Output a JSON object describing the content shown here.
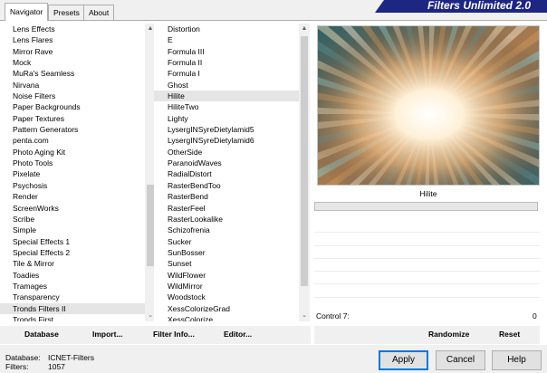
{
  "tabs": [
    {
      "label": "Navigator",
      "active": true
    },
    {
      "label": "Presets",
      "active": false
    },
    {
      "label": "About",
      "active": false
    }
  ],
  "banner_title": "Filters Unlimited 2.0",
  "categories": [
    {
      "label": "Lens Effects"
    },
    {
      "label": "Lens Flares"
    },
    {
      "label": "Mirror Rave"
    },
    {
      "label": "Mock"
    },
    {
      "label": "MuRa's Seamless"
    },
    {
      "label": "Nirvana"
    },
    {
      "label": "Noise Filters"
    },
    {
      "label": "Paper Backgrounds"
    },
    {
      "label": "Paper Textures"
    },
    {
      "label": "Pattern Generators"
    },
    {
      "label": "penta.com"
    },
    {
      "label": "Photo Aging Kit"
    },
    {
      "label": "Photo Tools"
    },
    {
      "label": "Pixelate"
    },
    {
      "label": "Psychosis"
    },
    {
      "label": "Render"
    },
    {
      "label": "ScreenWorks"
    },
    {
      "label": "Scribe"
    },
    {
      "label": "Simple"
    },
    {
      "label": "Special Effects 1"
    },
    {
      "label": "Special Effects 2"
    },
    {
      "label": "Tile & Mirror"
    },
    {
      "label": "Toadies"
    },
    {
      "label": "Tramages"
    },
    {
      "label": "Transparency"
    },
    {
      "label": "Tronds Filters II",
      "selected": true
    },
    {
      "label": "Tronds First"
    }
  ],
  "filters": [
    {
      "label": "Distortion"
    },
    {
      "label": "E"
    },
    {
      "label": "Formula III"
    },
    {
      "label": "Formula II"
    },
    {
      "label": "Formula I"
    },
    {
      "label": "Ghost"
    },
    {
      "label": "Hilite",
      "selected": true
    },
    {
      "label": "HiliteTwo"
    },
    {
      "label": "Lighty"
    },
    {
      "label": "LysergINSyreDietylamid5"
    },
    {
      "label": "LysergINSyreDietylamid6"
    },
    {
      "label": "OtherSide"
    },
    {
      "label": "ParanoidWaves"
    },
    {
      "label": "RadialDistort"
    },
    {
      "label": "RasterBendToo"
    },
    {
      "label": "RasterBend"
    },
    {
      "label": "RasterFeel"
    },
    {
      "label": "RasterLookalike"
    },
    {
      "label": "Schizofrenia"
    },
    {
      "label": "Sucker"
    },
    {
      "label": "SunBosser"
    },
    {
      "label": "Sunset"
    },
    {
      "label": "WildFlower"
    },
    {
      "label": "WildMirror"
    },
    {
      "label": "Woodstock"
    },
    {
      "label": "XessColorizeGrad"
    },
    {
      "label": "XessColorize"
    }
  ],
  "scroll_up_glyph": "▲",
  "scroll_down_glyph": "⌄",
  "preview_name": "Hilite",
  "control": {
    "label": "Control 7:",
    "value": "0"
  },
  "left_buttons": {
    "database": "Database",
    "import": "Import...",
    "filter_info": "Filter Info...",
    "editor": "Editor..."
  },
  "right_buttons": {
    "randomize": "Randomize",
    "reset": "Reset"
  },
  "info": {
    "database_label": "Database:",
    "database_value": "ICNET-Filters",
    "filters_label": "Filters:",
    "filters_value": "1057"
  },
  "dialog_buttons": {
    "apply": "Apply",
    "cancel": "Cancel",
    "help": "Help"
  },
  "colors": {
    "accent": "#0078d7",
    "banner": "#1d2680",
    "selection": "#e5e5e5"
  }
}
